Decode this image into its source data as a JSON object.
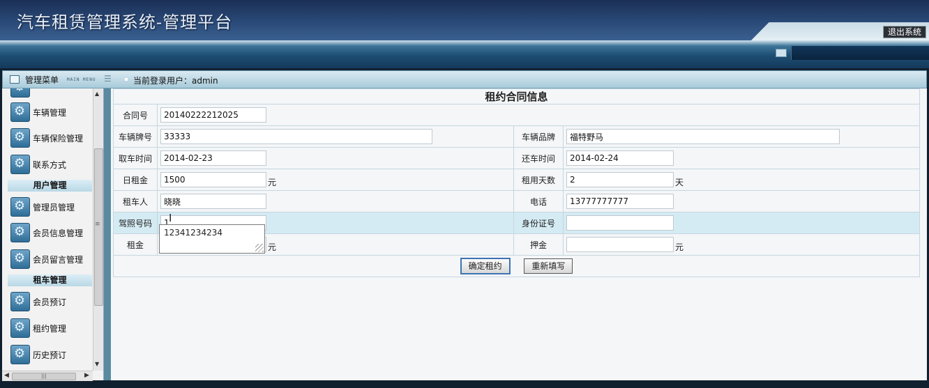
{
  "app": {
    "title": "汽车租赁管理系统-管理平台",
    "logout_label": "退出系统"
  },
  "menu": {
    "title": "管理菜单",
    "subtitle": "MAIN MENU",
    "current_user": "当前登录用户：admin"
  },
  "sidebar": {
    "items_top": [
      {
        "label": "车辆管理"
      },
      {
        "label": "车辆保险管理"
      },
      {
        "label": "联系方式"
      }
    ],
    "section_user": "用户管理",
    "items_user": [
      {
        "label": "管理员管理"
      },
      {
        "label": "会员信息管理"
      },
      {
        "label": "会员留言管理"
      }
    ],
    "section_rent": "租车管理",
    "items_rent": [
      {
        "label": "会员预订"
      },
      {
        "label": "租约管理"
      },
      {
        "label": "历史预订"
      }
    ]
  },
  "form": {
    "title": "租约合同信息",
    "contract_no": {
      "label": "合同号",
      "value": "20140222212025"
    },
    "plate": {
      "label": "车辆牌号",
      "value": "33333"
    },
    "brand": {
      "label": "车辆品牌",
      "value": "福特野马"
    },
    "pickup_time": {
      "label": "取车时间",
      "value": "2014-02-23"
    },
    "return_time": {
      "label": "还车时间",
      "value": "2014-02-24"
    },
    "daily_rent": {
      "label": "日租金",
      "value": "1500",
      "unit": "元"
    },
    "rent_days": {
      "label": "租用天数",
      "value": "2",
      "unit": "天"
    },
    "renter": {
      "label": "租车人",
      "value": "晓晓"
    },
    "phone": {
      "label": "电话",
      "value": "13777777777"
    },
    "license_no": {
      "label": "驾照号码",
      "value": "1"
    },
    "id_card": {
      "label": "身份证号",
      "value": ""
    },
    "rent": {
      "label": "租金",
      "value": "",
      "unit": "元"
    },
    "deposit": {
      "label": "押金",
      "value": "",
      "unit": "元"
    },
    "autocomplete_suggestion": "12341234234",
    "confirm_label": "确定租约",
    "reset_label": "重新填写"
  }
}
